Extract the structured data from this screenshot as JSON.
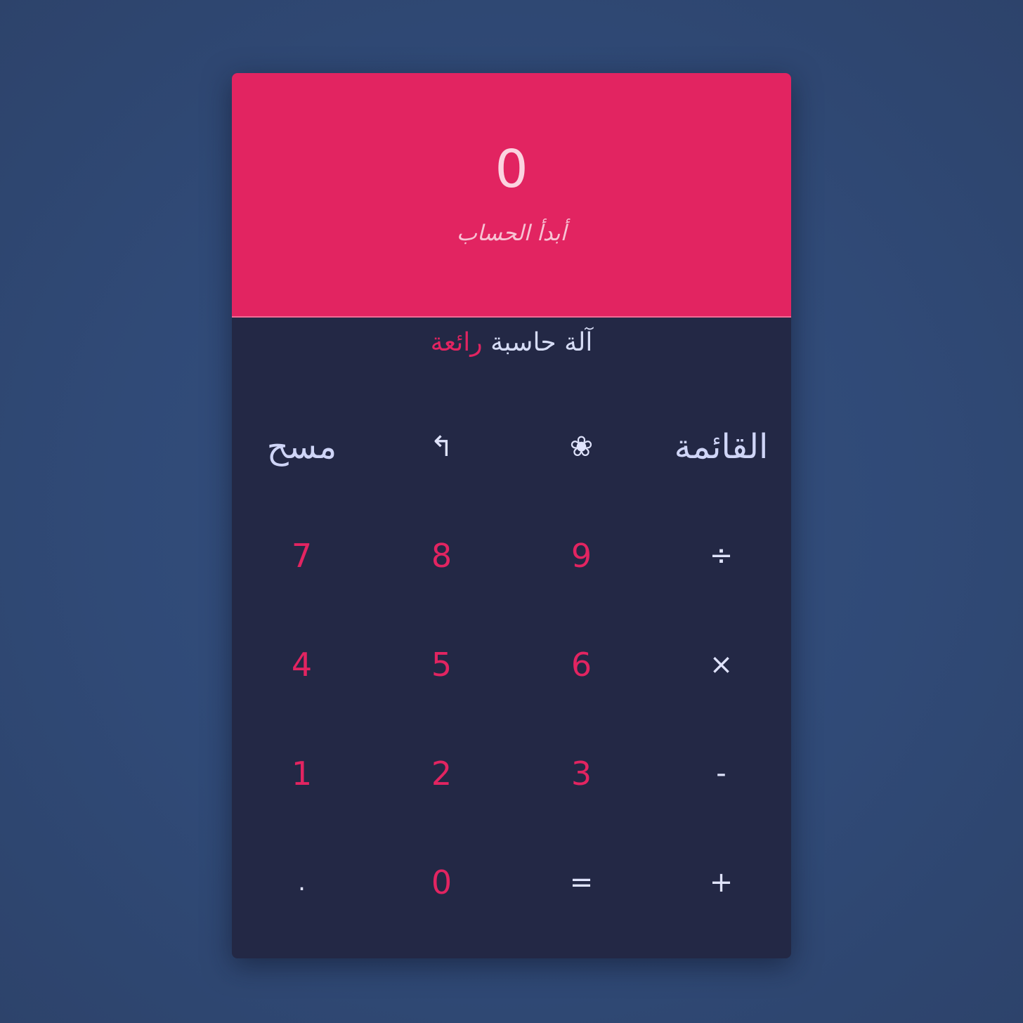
{
  "display": {
    "value": "0",
    "hint": "أبدأ الحساب"
  },
  "title": {
    "main": "آلة حاسبة",
    "accent": "رائعة"
  },
  "colors": {
    "accent": "#e22461",
    "panel": "#232845",
    "background": "#304a77",
    "light_text": "#d6dcf5"
  },
  "keys": {
    "clear": "مسح",
    "backspace_icon": "↰",
    "flower_icon": "❀",
    "menu": "القائمة",
    "seven": "7",
    "eight": "8",
    "nine": "9",
    "divide": "÷",
    "four": "4",
    "five": "5",
    "six": "6",
    "multiply": "×",
    "one": "1",
    "two": "2",
    "three": "3",
    "minus": "-",
    "dot": ".",
    "zero": "0",
    "equals": "=",
    "plus": "+"
  },
  "icons": {
    "backspace": "backspace-icon",
    "flower": "flower-icon"
  }
}
